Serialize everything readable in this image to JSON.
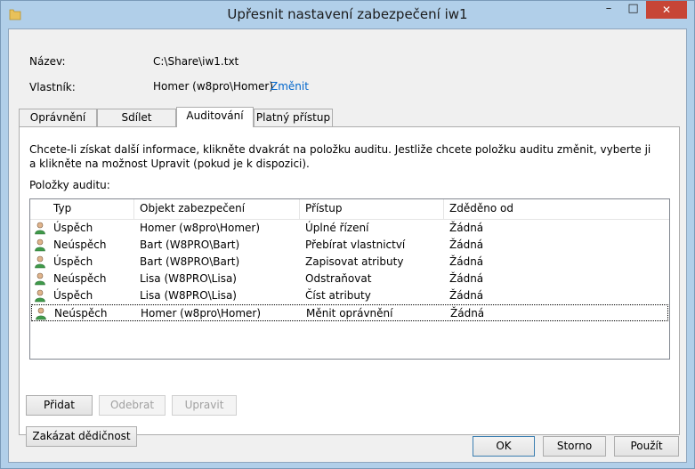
{
  "window": {
    "title": "Upřesnit nastavení zabezpečení iw1"
  },
  "info": {
    "name_label": "Název:",
    "name_value": "C:\\Share\\iw1.txt",
    "owner_label": "Vlastník:",
    "owner_value": "Homer (w8pro\\Homer)",
    "change_link": "Změnit"
  },
  "tabs": [
    {
      "label": "Oprávnění"
    },
    {
      "label": "Sdílet"
    },
    {
      "label": "Auditování"
    },
    {
      "label": "Platný přístup"
    }
  ],
  "active_tab": "Auditování",
  "panel": {
    "description": "Chcete-li získat další informace, klikněte dvakrát na položku auditu. Jestliže chcete položku auditu změnit, vyberte ji a klikněte na možnost Upravit (pokud je k dispozici).",
    "list_label": "Položky auditu:",
    "columns": [
      "Typ",
      "Objekt zabezpečení",
      "Přístup",
      "Zděděno od"
    ],
    "rows": [
      {
        "type": "Úspěch",
        "principal": "Homer (w8pro\\Homer)",
        "access": "Úplné řízení",
        "inherited": "Žádná"
      },
      {
        "type": "Neúspěch",
        "principal": "Bart (W8PRO\\Bart)",
        "access": "Přebírat vlastnictví",
        "inherited": "Žádná"
      },
      {
        "type": "Úspěch",
        "principal": "Bart (W8PRO\\Bart)",
        "access": "Zapisovat atributy",
        "inherited": "Žádná"
      },
      {
        "type": "Neúspěch",
        "principal": "Lisa (W8PRO\\Lisa)",
        "access": "Odstraňovat",
        "inherited": "Žádná"
      },
      {
        "type": "Úspěch",
        "principal": "Lisa (W8PRO\\Lisa)",
        "access": "Číst atributy",
        "inherited": "Žádná"
      },
      {
        "type": "Neúspěch",
        "principal": "Homer (w8pro\\Homer)",
        "access": "Měnit oprávnění",
        "inherited": "Žádná"
      }
    ],
    "selected_row": 5,
    "buttons": {
      "add": "Přidat",
      "remove": "Odebrat",
      "edit": "Upravit",
      "disable_inheritance": "Zakázat dědičnost"
    }
  },
  "footer": {
    "ok": "OK",
    "cancel": "Storno",
    "apply": "Použít"
  },
  "colors": {
    "title_bar": "#b1cfe9",
    "close_button": "#c74536",
    "link": "#0066cc"
  }
}
